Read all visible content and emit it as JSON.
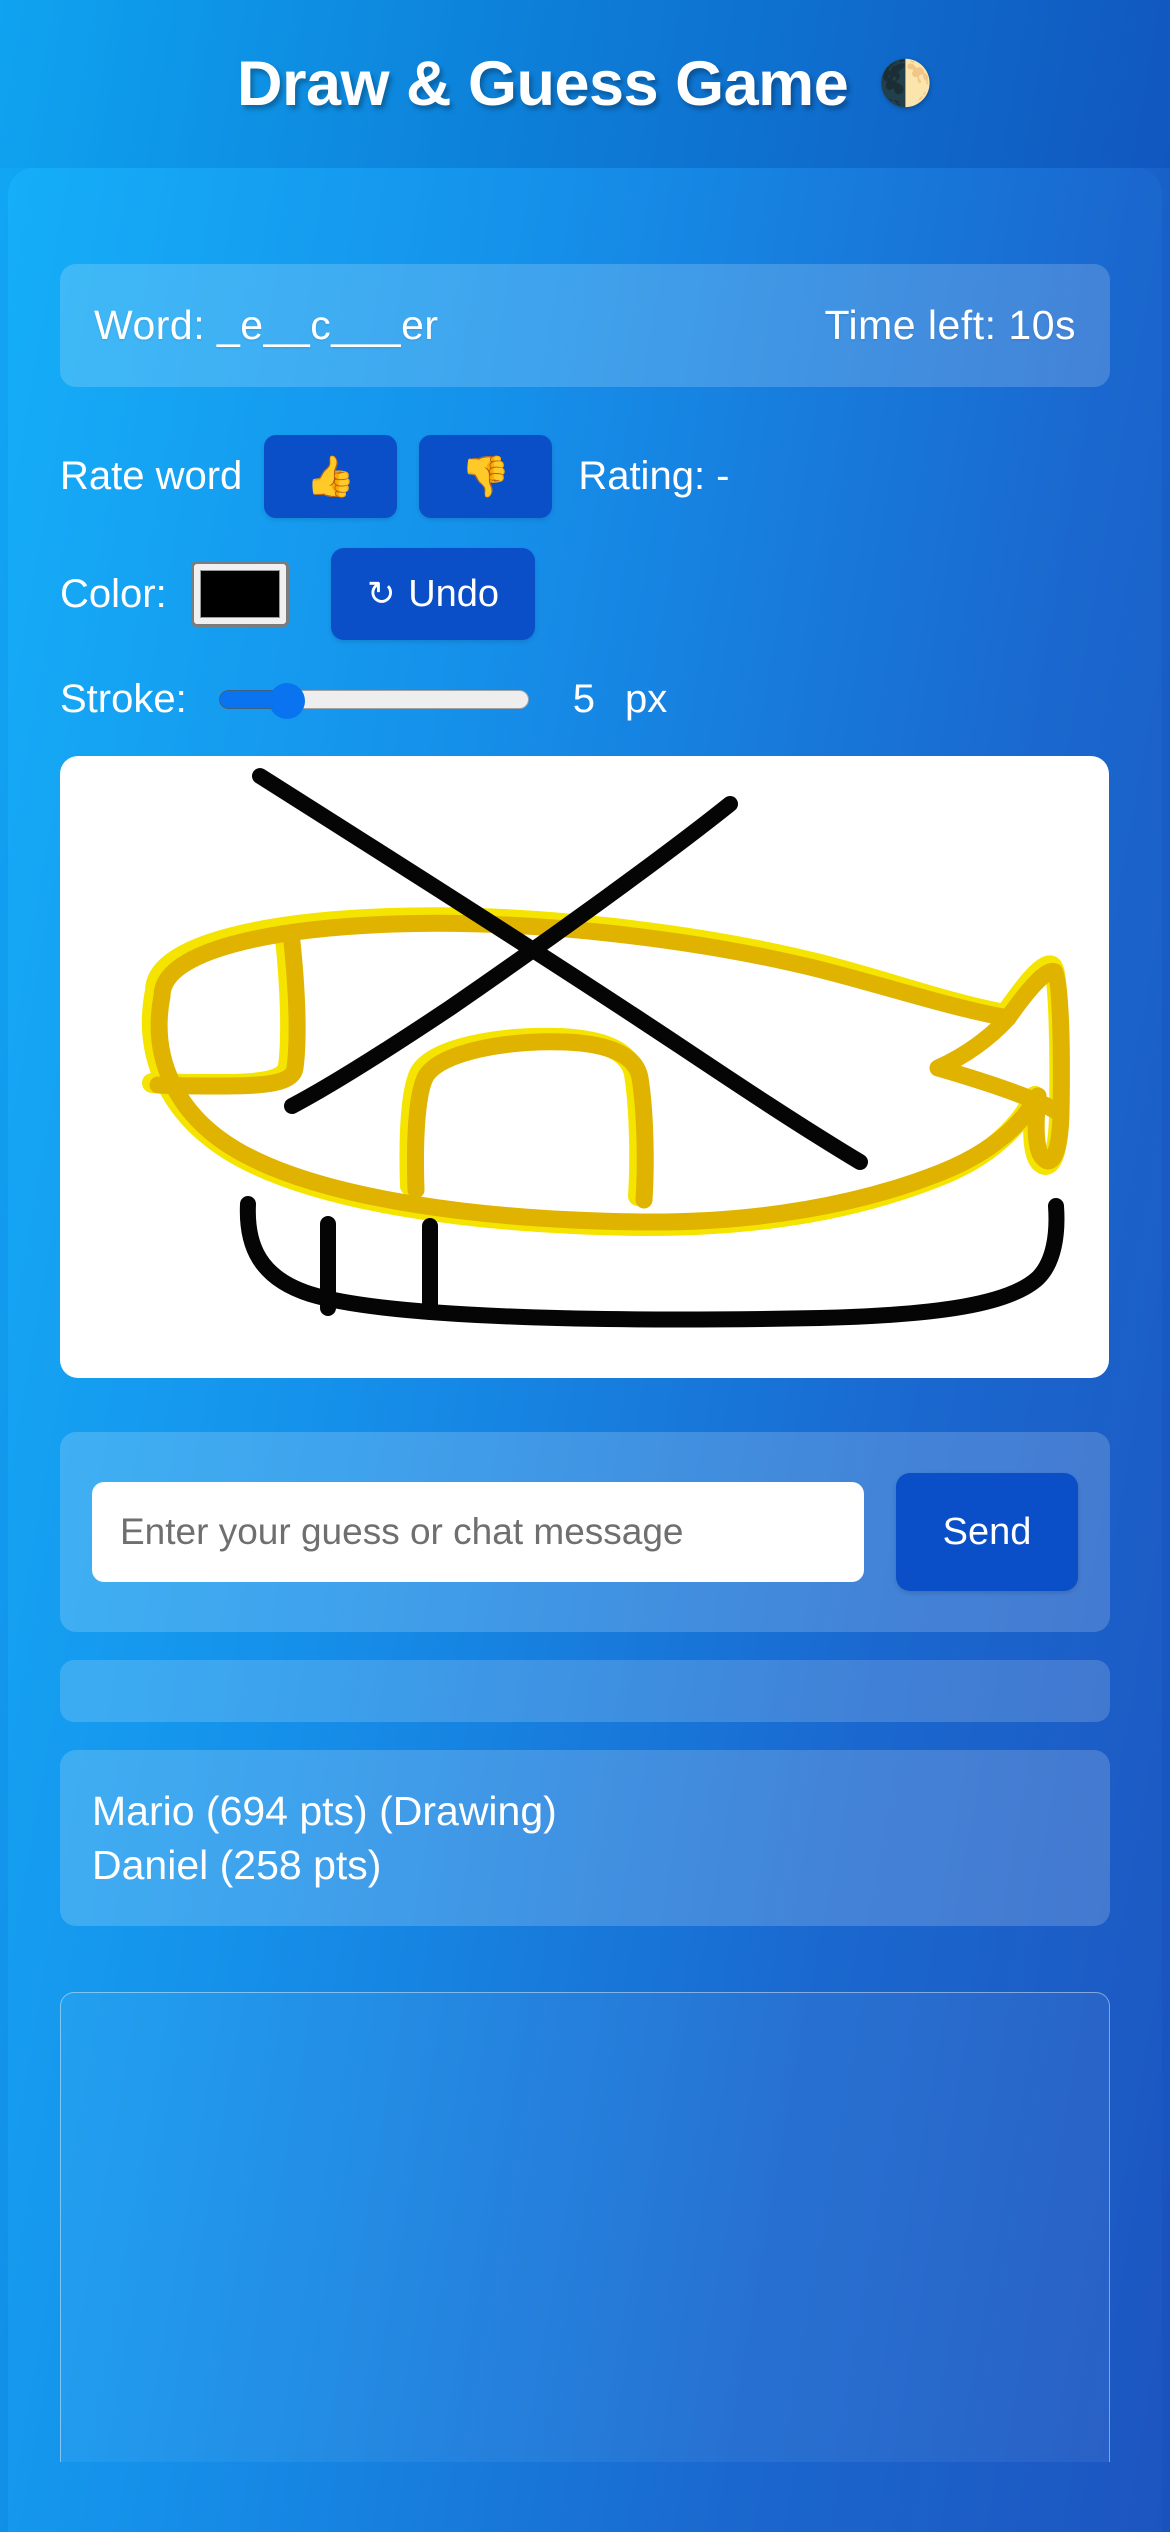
{
  "header": {
    "title": "Draw & Guess Game",
    "moon_icon": "🌓"
  },
  "word_bar": {
    "word_label": "Word: _e__c___er",
    "timer_label": "Time left: 10s"
  },
  "rate_row": {
    "label": "Rate word",
    "thumbs_up_icon": "👍",
    "thumbs_down_icon": "👎",
    "rating_label": "Rating: -"
  },
  "color_row": {
    "label": "Color:",
    "selected_color": "#000000",
    "undo_label": "Undo",
    "undo_icon": "↺"
  },
  "stroke_row": {
    "label": "Stroke:",
    "value": "5",
    "unit": "px",
    "min": "1",
    "max": "20",
    "percent": 22
  },
  "canvas": {
    "background": "#ffffff",
    "drawing_subject": "helicopter",
    "colors": {
      "body": "#e0b400",
      "body_highlight": "#f5e400",
      "outline": "#000000"
    }
  },
  "chat": {
    "input_value": "",
    "placeholder": "Enter your guess or chat message",
    "send_label": "Send"
  },
  "status_bar": {
    "text": ""
  },
  "players": [
    {
      "line": "Mario (694 pts) (Drawing)"
    },
    {
      "line": "Daniel (258 pts)"
    }
  ],
  "bottom_panel": {
    "text": ""
  },
  "colors": {
    "accent_button": "#0a4ec8",
    "slider_fill": "#0a74f0",
    "background_start": "#12a7f5",
    "background_end": "#1a51bd"
  }
}
